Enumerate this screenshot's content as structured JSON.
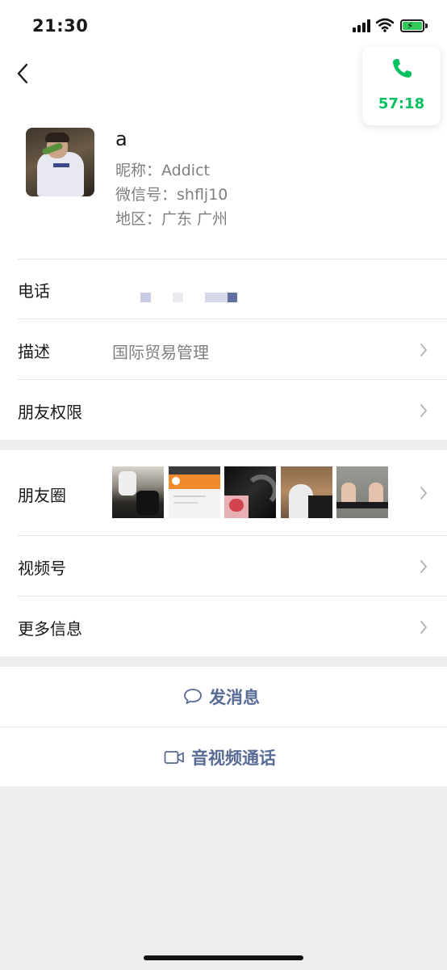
{
  "status_bar": {
    "time": "21:30"
  },
  "call_float": {
    "timer": "57:18",
    "color": "#07c160"
  },
  "profile": {
    "name": "a",
    "nickname": "昵称：Addict",
    "wechat_id": "微信号：shflj10",
    "region": "地区：广东 广州"
  },
  "rows": {
    "phone": {
      "label": "电话"
    },
    "description": {
      "label": "描述",
      "value": "国际贸易管理"
    },
    "permissions": {
      "label": "朋友权限"
    },
    "moments": {
      "label": "朋友圈"
    },
    "channels": {
      "label": "视频号"
    },
    "more_info": {
      "label": "更多信息"
    }
  },
  "actions": {
    "message": "发消息",
    "video_call": "音视频通话",
    "link_color": "#576b95"
  }
}
